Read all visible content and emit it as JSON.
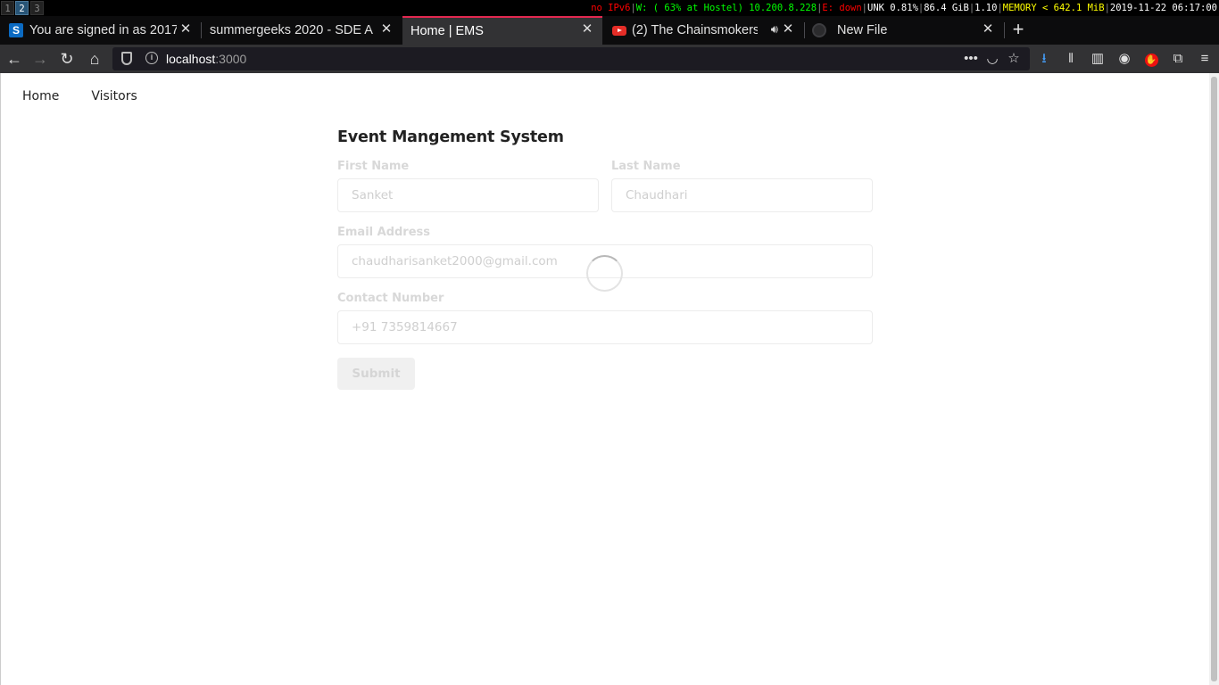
{
  "statusbar": {
    "workspaces": [
      "1",
      "2",
      "3"
    ],
    "ipv6": "no IPv6",
    "wireless": "W: ( 63% at Hostel) 10.200.8.228",
    "ethernet": "E: down",
    "battery": "UNK 0.81%",
    "disk": "86.4 GiB",
    "load": "1.10",
    "memory": "MEMORY < 642.1 MiB",
    "datetime": "2019-11-22 06:17:00",
    "colors": {
      "red": "#ff0000",
      "green": "#00ff00",
      "yellow": "#ffff00"
    }
  },
  "tabs": [
    {
      "title": "You are signed in as 2017",
      "icon": "s-favicon-icon"
    },
    {
      "title": "summergeeks 2020 - SDE A",
      "icon": "none"
    },
    {
      "title": "Home | EMS",
      "icon": "none",
      "active": true
    },
    {
      "title": "(2) The Chainsmokers",
      "icon": "youtube-icon",
      "audio": true
    },
    {
      "title": "New File",
      "icon": "github-icon"
    }
  ],
  "navbar": {
    "url_host": "localhost",
    "url_port": ":3000"
  },
  "page": {
    "nav": {
      "home": "Home",
      "visitors": "Visitors"
    },
    "form": {
      "title": "Event Mangement System",
      "first_name_label": "First Name",
      "first_name_value": "Sanket",
      "last_name_label": "Last Name",
      "last_name_value": "Chaudhari",
      "email_label": "Email Address",
      "email_value": "chaudharisanket2000@gmail.com",
      "contact_label": "Contact Number",
      "contact_value": "+91 7359814667",
      "submit_label": "Submit"
    },
    "loading": true
  }
}
